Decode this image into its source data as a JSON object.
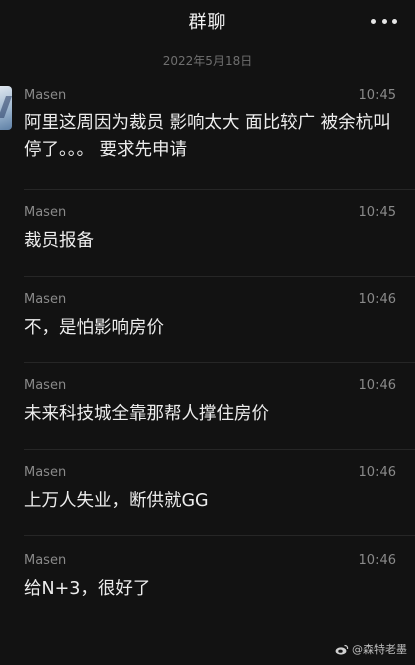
{
  "header": {
    "title": "群聊",
    "more_icon": "more-dots-icon"
  },
  "date_divider": "2022年5月18日",
  "messages": [
    {
      "sender": "Masen",
      "time": "10:45",
      "text": "阿里这周因为裁员 影响太大 面比较广 被余杭叫停了。。。 要求先申请"
    },
    {
      "sender": "Masen",
      "time": "10:45",
      "text": "裁员报备"
    },
    {
      "sender": "Masen",
      "time": "10:46",
      "text": "不，是怕影响房价"
    },
    {
      "sender": "Masen",
      "time": "10:46",
      "text": "未来科技城全靠那帮人撑住房价"
    },
    {
      "sender": "Masen",
      "time": "10:46",
      "text": "上万人失业，断供就GG"
    },
    {
      "sender": "Masen",
      "time": "10:46",
      "text": "给N+3，很好了"
    }
  ],
  "watermark": {
    "icon": "weibo-logo-icon",
    "text": "@森特老墨"
  },
  "colors": {
    "background": "#121212",
    "text_primary": "#ededed",
    "text_secondary": "#8a8a8a"
  }
}
